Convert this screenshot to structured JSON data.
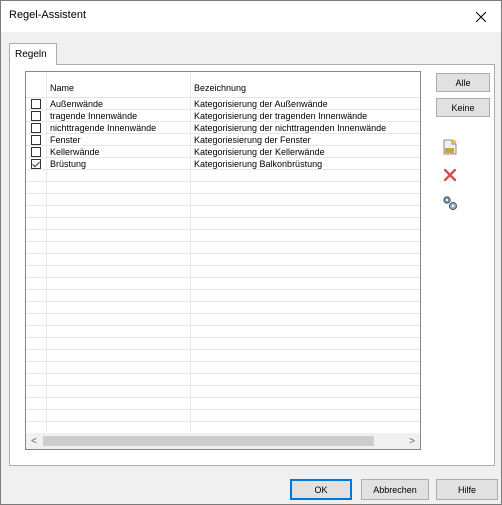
{
  "window": {
    "title": "Regel-Assistent"
  },
  "tabs": [
    {
      "label": "Regeln"
    }
  ],
  "table": {
    "columns": {
      "name": "Name",
      "desc": "Bezeichnung"
    },
    "rows": [
      {
        "checked": false,
        "name": "Außenwände",
        "desc": "Kategorisierung der Außenwände"
      },
      {
        "checked": false,
        "name": "tragende Innenwände",
        "desc": "Kategorisierung der tragenden Innenwände"
      },
      {
        "checked": false,
        "name": "nichttragende Innenwände",
        "desc": "Kategorisierung der nichttragenden Innenwände"
      },
      {
        "checked": false,
        "name": "Fenster",
        "desc": "Kategoriesierung der Fenster"
      },
      {
        "checked": false,
        "name": "Kellerwände",
        "desc": "Kategorisierung der Kellerwände"
      },
      {
        "checked": true,
        "name": "Brüstung",
        "desc": "Kategorisierung Balkonbrüstung"
      }
    ]
  },
  "side": {
    "all_label": "Alle",
    "none_label": "Keine"
  },
  "icons": {
    "close": "close-icon",
    "new": "new-document-icon",
    "delete": "delete-icon",
    "settings": "settings-gear-icon"
  },
  "footer": {
    "ok": "OK",
    "cancel": "Abbrechen",
    "help": "Hilfe"
  }
}
